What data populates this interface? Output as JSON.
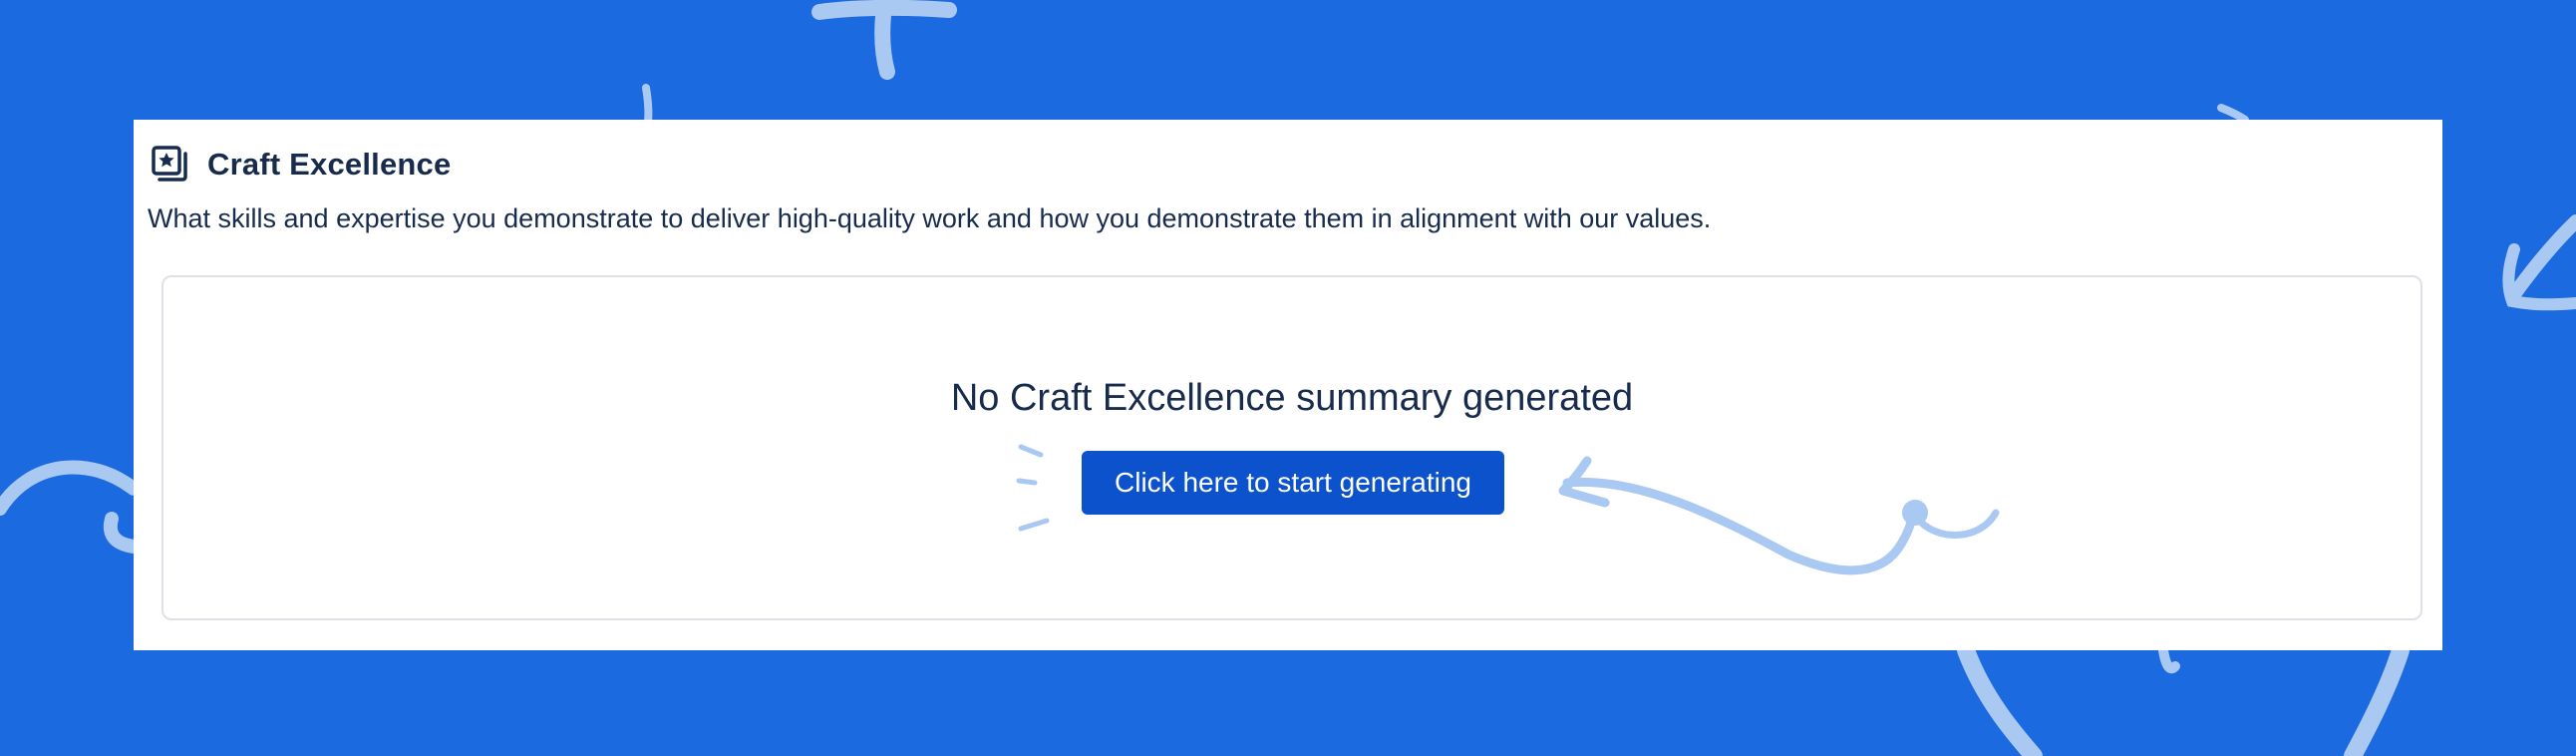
{
  "section": {
    "title": "Craft Excellence",
    "description": "What skills and expertise you demonstrate to deliver high-quality work and how you demonstrate them in alignment with our values.",
    "icon": "star-gallery-icon"
  },
  "empty_state": {
    "message": "No Craft Excellence summary generated",
    "button_label": "Click here to start generating"
  },
  "colors": {
    "background": "#1b6adf",
    "card": "#ffffff",
    "text": "#172b4d",
    "button": "#0c52cc",
    "doodle": "#a9c8f2"
  }
}
